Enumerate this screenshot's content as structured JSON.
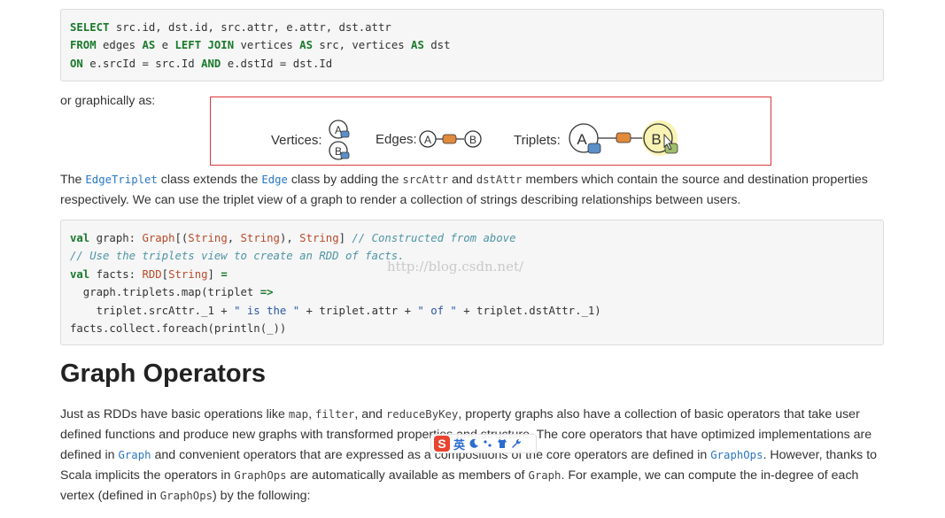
{
  "sql_code": [
    [
      {
        "t": "SELECT",
        "c": "kw"
      },
      {
        "t": " src.id, dst.id, src.attr, e.attr, dst.attr",
        "c": ""
      }
    ],
    [
      {
        "t": "FROM",
        "c": "kw"
      },
      {
        "t": " edges ",
        "c": ""
      },
      {
        "t": "AS",
        "c": "kw"
      },
      {
        "t": " e ",
        "c": ""
      },
      {
        "t": "LEFT JOIN",
        "c": "kw"
      },
      {
        "t": " vertices ",
        "c": ""
      },
      {
        "t": "AS",
        "c": "kw"
      },
      {
        "t": " src, vertices ",
        "c": ""
      },
      {
        "t": "AS",
        "c": "kw"
      },
      {
        "t": " dst",
        "c": ""
      }
    ],
    [
      {
        "t": "ON",
        "c": "kw"
      },
      {
        "t": " e.srcId = src.Id ",
        "c": ""
      },
      {
        "t": "AND",
        "c": "kw"
      },
      {
        "t": " e.dstId = dst.Id",
        "c": ""
      }
    ]
  ],
  "graphically_text": "or graphically as:",
  "figure": {
    "vertices_label": "Vertices:",
    "edges_label": "Edges:",
    "triplets_label": "Triplets:",
    "node_a": "A",
    "node_b": "B",
    "colors": {
      "vertex_attr": "#5b8fc9",
      "edge_attr": "#e08a3c",
      "dst_attr": "#9fbf6a",
      "highlight": "#f7f0a0",
      "box_border": "#d9373a"
    }
  },
  "para1": [
    {
      "t": "The ",
      "k": "text"
    },
    {
      "t": "EdgeTriplet",
      "k": "link"
    },
    {
      "t": " class extends the ",
      "k": "text"
    },
    {
      "t": "Edge",
      "k": "link"
    },
    {
      "t": " class by adding the ",
      "k": "text"
    },
    {
      "t": "srcAttr",
      "k": "code"
    },
    {
      "t": " and ",
      "k": "text"
    },
    {
      "t": "dstAttr",
      "k": "code"
    },
    {
      "t": " members which contain the source and destination properties respectively. We can use the triplet view of a graph to render a collection of strings describing relationships between users.",
      "k": "text"
    }
  ],
  "scala_code": [
    [
      {
        "t": "val",
        "c": "kw"
      },
      {
        "t": " graph: ",
        "c": ""
      },
      {
        "t": "Graph",
        "c": "ty"
      },
      {
        "t": "[(",
        "c": ""
      },
      {
        "t": "String",
        "c": "ty"
      },
      {
        "t": ", ",
        "c": ""
      },
      {
        "t": "String",
        "c": "ty"
      },
      {
        "t": "), ",
        "c": ""
      },
      {
        "t": "String",
        "c": "ty"
      },
      {
        "t": "] ",
        "c": ""
      },
      {
        "t": "// Constructed from above",
        "c": "cm"
      }
    ],
    [
      {
        "t": "// Use the triplets view to create an RDD of facts.",
        "c": "cm"
      }
    ],
    [
      {
        "t": "val",
        "c": "kw"
      },
      {
        "t": " facts: ",
        "c": ""
      },
      {
        "t": "RDD",
        "c": "ty"
      },
      {
        "t": "[",
        "c": ""
      },
      {
        "t": "String",
        "c": "ty"
      },
      {
        "t": "] ",
        "c": ""
      },
      {
        "t": "=",
        "c": "kw"
      }
    ],
    [
      {
        "t": "  graph.triplets.map(triplet ",
        "c": ""
      },
      {
        "t": "=>",
        "c": "kw"
      }
    ],
    [
      {
        "t": "    triplet.srcAttr._1 + ",
        "c": ""
      },
      {
        "t": "\" is the \"",
        "c": "st"
      },
      {
        "t": " + triplet.attr + ",
        "c": ""
      },
      {
        "t": "\" of \"",
        "c": "st"
      },
      {
        "t": " + triplet.dstAttr._1)",
        "c": ""
      }
    ],
    [
      {
        "t": "facts.collect.foreach(println(_))",
        "c": ""
      }
    ]
  ],
  "watermark": "http://blog.csdn.net/",
  "heading": "Graph Operators",
  "para2": [
    {
      "t": "Just as RDDs have basic operations like ",
      "k": "text"
    },
    {
      "t": "map",
      "k": "code"
    },
    {
      "t": ", ",
      "k": "text"
    },
    {
      "t": "filter",
      "k": "code"
    },
    {
      "t": ", and ",
      "k": "text"
    },
    {
      "t": "reduceByKey",
      "k": "code"
    },
    {
      "t": ", property graphs also have a collection of basic operators that take user defined functions and produce new graphs with transformed properties and structure. The core operators that have optimized implementations are defined in ",
      "k": "text"
    },
    {
      "t": "Graph",
      "k": "link"
    },
    {
      "t": " and convenient operators that are expressed as a compositions of the core operators are defined in ",
      "k": "text"
    },
    {
      "t": "GraphOps",
      "k": "link"
    },
    {
      "t": ". However, thanks to Scala implicits the operators in ",
      "k": "text"
    },
    {
      "t": "GraphOps",
      "k": "code"
    },
    {
      "t": " are automatically available as members of ",
      "k": "text"
    },
    {
      "t": "Graph",
      "k": "code"
    },
    {
      "t": ". For example, we can compute the in-degree of each vertex (defined in ",
      "k": "text"
    },
    {
      "t": "GraphOps",
      "k": "code"
    },
    {
      "t": ") by the following:",
      "k": "text"
    }
  ],
  "ime": {
    "logo": "S",
    "mode": "英"
  }
}
